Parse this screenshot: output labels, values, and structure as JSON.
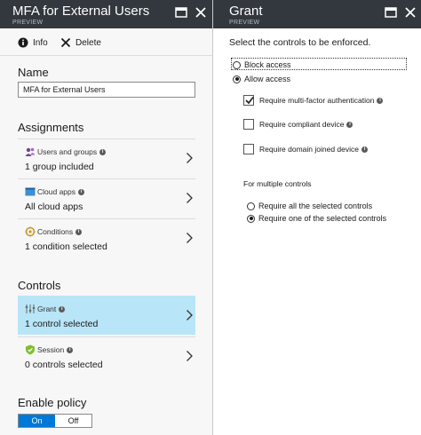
{
  "left_blade": {
    "title": "MFA for External Users",
    "subtitle": "PREVIEW",
    "toolbar": {
      "info_label": "Info",
      "delete_label": "Delete"
    },
    "name_section": {
      "label": "Name",
      "value": "MFA for External Users"
    },
    "assignments": {
      "label": "Assignments",
      "items": [
        {
          "label": "Users and groups",
          "value": "1 group included",
          "icon": "users-icon"
        },
        {
          "label": "Cloud apps",
          "value": "All cloud apps",
          "icon": "cloud-app-icon"
        },
        {
          "label": "Conditions",
          "value": "1 condition selected",
          "icon": "conditions-icon"
        }
      ]
    },
    "controls": {
      "label": "Controls",
      "items": [
        {
          "label": "Grant",
          "value": "1 control selected",
          "icon": "grant-icon",
          "selected": true
        },
        {
          "label": "Session",
          "value": "0 controls selected",
          "icon": "session-icon",
          "selected": false
        }
      ]
    },
    "enable_policy": {
      "label": "Enable policy",
      "on_label": "On",
      "off_label": "Off",
      "selected": "On"
    }
  },
  "right_blade": {
    "title": "Grant",
    "subtitle": "PREVIEW",
    "instruction": "Select the controls to be enforced.",
    "access_options": [
      {
        "label": "Block access",
        "checked": false
      },
      {
        "label": "Allow access",
        "checked": true
      }
    ],
    "controls": [
      {
        "label": "Require multi-factor authentication",
        "checked": true
      },
      {
        "label": "Require compliant device",
        "checked": false
      },
      {
        "label": "Require domain joined device",
        "checked": false
      }
    ],
    "multiple_controls": {
      "label": "For multiple controls",
      "options": [
        {
          "label": "Require all the selected controls",
          "checked": false
        },
        {
          "label": "Require one of the selected controls",
          "checked": true
        }
      ]
    }
  },
  "colors": {
    "header_bg": "#32383e",
    "selected_item_bg": "#b8e5f8",
    "toggle_on_bg": "#0078d7",
    "check_mark": "#1a1a1a"
  }
}
